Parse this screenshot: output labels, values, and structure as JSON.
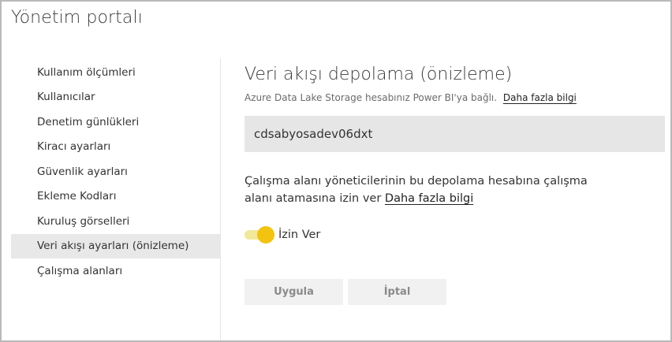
{
  "app": {
    "title": "Yönetim portalı"
  },
  "sidebar": {
    "items": [
      {
        "label": "Kullanım ölçümleri"
      },
      {
        "label": "Kullanıcılar"
      },
      {
        "label": "Denetim günlükleri"
      },
      {
        "label": "Kiracı ayarları"
      },
      {
        "label": "Güvenlik ayarları"
      },
      {
        "label": "Ekleme Kodları"
      },
      {
        "label": "Kuruluş görselleri"
      },
      {
        "label": "Veri akışı ayarları (önizleme)",
        "active": true
      },
      {
        "label": "Çalışma alanları"
      }
    ]
  },
  "main": {
    "title": "Veri akışı depolama (önizleme)",
    "subtitle": "Azure Data Lake Storage hesabınız Power BI'ya bağlı.",
    "subtitle_link": "Daha fazla bilgi",
    "account_name": "cdsabyosadev06dxt",
    "description": "Çalışma alanı yöneticilerinin bu depolama hesabına çalışma alanı atamasına izin ver",
    "description_link": "Daha fazla bilgi",
    "toggle": {
      "label": "İzin Ver",
      "state": "on"
    },
    "buttons": {
      "apply": "Uygula",
      "cancel": "İptal"
    }
  },
  "colors": {
    "accent": "#f2c30f",
    "toggle_track": "#f3e89a",
    "active_item_bg": "#e8e8e8",
    "input_bg": "#e6e6e6"
  }
}
